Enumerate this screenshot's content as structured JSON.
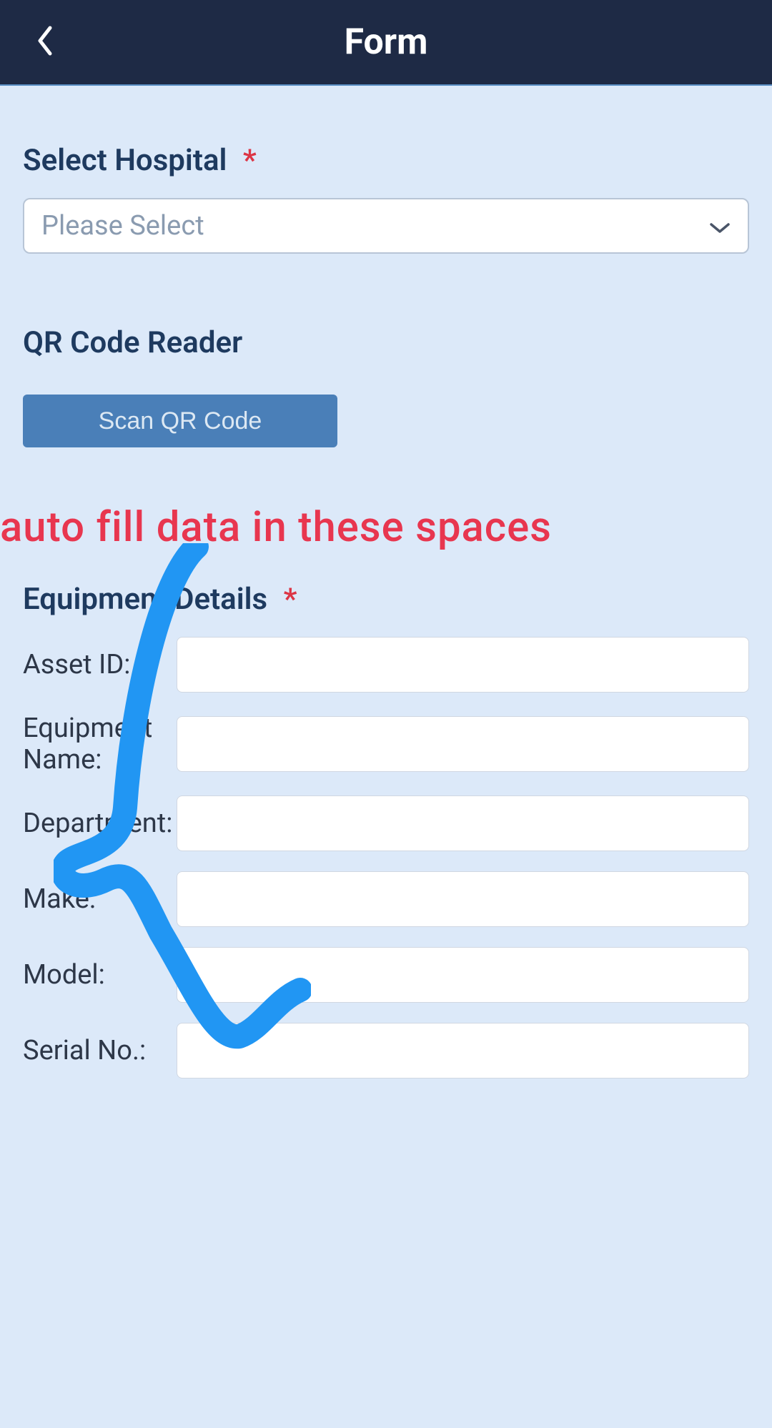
{
  "header": {
    "title": "Form"
  },
  "hospital": {
    "label": "Select Hospital",
    "placeholder": "Please Select"
  },
  "qr": {
    "label": "QR Code Reader",
    "button": "Scan QR Code"
  },
  "annotation": {
    "text": "auto fill data in these spaces"
  },
  "equipment": {
    "title": "Equipment Details",
    "fields": {
      "assetId": {
        "label": "Asset ID:",
        "value": ""
      },
      "equipmentName": {
        "label": "Equipment Name:",
        "value": ""
      },
      "department": {
        "label": "Department:",
        "value": ""
      },
      "make": {
        "label": "Make:",
        "value": ""
      },
      "model": {
        "label": "Model:",
        "value": ""
      },
      "serialNo": {
        "label": "Serial No.:",
        "value": ""
      }
    }
  },
  "colors": {
    "headerBg": "#1e2a45",
    "bodyBg": "#dce9f9",
    "labelText": "#1e3a5f",
    "required": "#dc3545",
    "buttonBg": "#4a7fb8",
    "annotation": "#e8364f",
    "drawing": "#2196f3"
  }
}
